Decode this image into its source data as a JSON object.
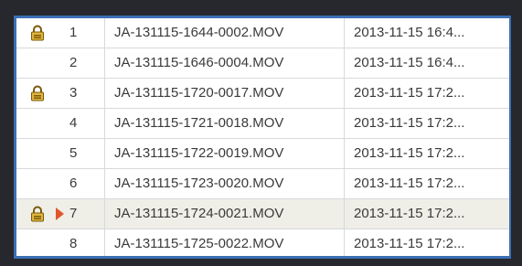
{
  "window": {
    "colors": {
      "frame": "#26282d",
      "border": "#3c6fb5",
      "row_divider": "#d7d9dc",
      "selected_row": "#efefe7",
      "lock_icon": "#e0b53c",
      "marker_icon": "#e2552b"
    }
  },
  "table": {
    "rows": [
      {
        "locked": true,
        "marker": false,
        "number": "1",
        "name": "JA-131115-1644-0002.MOV",
        "date": "2013-11-15 16:4..."
      },
      {
        "locked": false,
        "marker": false,
        "number": "2",
        "name": "JA-131115-1646-0004.MOV",
        "date": "2013-11-15 16:4..."
      },
      {
        "locked": true,
        "marker": false,
        "number": "3",
        "name": "JA-131115-1720-0017.MOV",
        "date": "2013-11-15 17:2..."
      },
      {
        "locked": false,
        "marker": false,
        "number": "4",
        "name": "JA-131115-1721-0018.MOV",
        "date": "2013-11-15 17:2..."
      },
      {
        "locked": false,
        "marker": false,
        "number": "5",
        "name": "JA-131115-1722-0019.MOV",
        "date": "2013-11-15 17:2..."
      },
      {
        "locked": false,
        "marker": false,
        "number": "6",
        "name": "JA-131115-1723-0020.MOV",
        "date": "2013-11-15 17:2..."
      },
      {
        "locked": true,
        "marker": true,
        "number": "7",
        "name": "JA-131115-1724-0021.MOV",
        "date": "2013-11-15 17:2...",
        "selected": true
      },
      {
        "locked": false,
        "marker": false,
        "number": "8",
        "name": "JA-131115-1725-0022.MOV",
        "date": "2013-11-15 17:2..."
      }
    ]
  }
}
